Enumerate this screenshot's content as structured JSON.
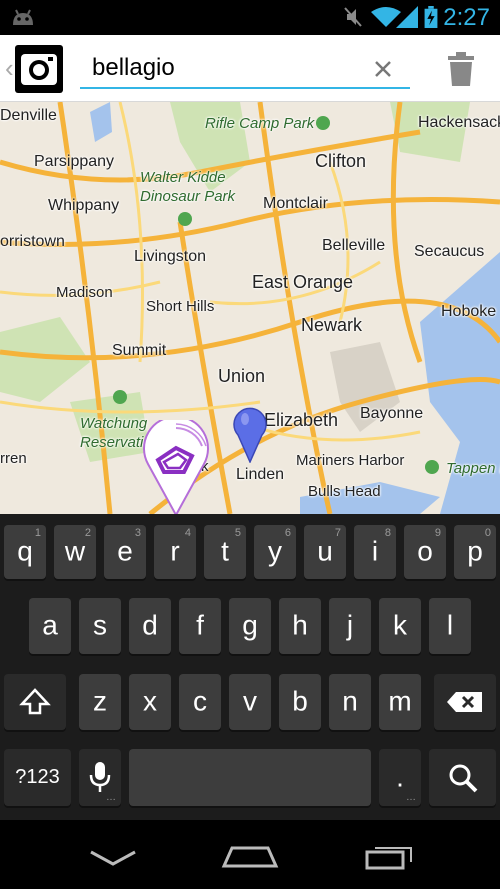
{
  "statusbar": {
    "time": "2:27",
    "icons": [
      "android-icon",
      "mute-icon",
      "wifi-icon",
      "signal-icon",
      "battery-charging-icon"
    ],
    "accent_color": "#33b5e5"
  },
  "actionbar": {
    "search_value": "bellagio",
    "app_icon": "camera-icon",
    "clear_icon": "close-icon",
    "trash_icon": "trash-icon"
  },
  "map": {
    "labels": [
      {
        "name": "Denville",
        "cls": ""
      },
      {
        "name": "Rifle Camp Park",
        "cls": "park"
      },
      {
        "name": "Hackensack",
        "cls": ""
      },
      {
        "name": "Parsippany",
        "cls": ""
      },
      {
        "name": "Clifton",
        "cls": "big"
      },
      {
        "name": "Walter Kidde Dinosaur Park",
        "cls": "park"
      },
      {
        "name": "Whippany",
        "cls": ""
      },
      {
        "name": "Montclair",
        "cls": ""
      },
      {
        "name": "orristown",
        "cls": ""
      },
      {
        "name": "Livingston",
        "cls": ""
      },
      {
        "name": "Belleville",
        "cls": ""
      },
      {
        "name": "Secaucus",
        "cls": ""
      },
      {
        "name": "Madison",
        "cls": ""
      },
      {
        "name": "East Orange",
        "cls": "big"
      },
      {
        "name": "Short Hills",
        "cls": ""
      },
      {
        "name": "Hoboke",
        "cls": ""
      },
      {
        "name": "Newark",
        "cls": "big"
      },
      {
        "name": "Summit",
        "cls": ""
      },
      {
        "name": "Union",
        "cls": "big"
      },
      {
        "name": "Watchung Reservation",
        "cls": "park"
      },
      {
        "name": "Elizabeth",
        "cls": "big"
      },
      {
        "name": "Bayonne",
        "cls": ""
      },
      {
        "name": "rren",
        "cls": ""
      },
      {
        "name": "Linden",
        "cls": ""
      },
      {
        "name": "Mariners Harbor",
        "cls": ""
      },
      {
        "name": "Tappen P",
        "cls": "park"
      },
      {
        "name": "Bulls Head",
        "cls": ""
      },
      {
        "name": "k",
        "cls": ""
      }
    ],
    "marker_icon": "map-pin-icon",
    "location_icon": "location-marker-icon"
  },
  "keyboard": {
    "row1": [
      {
        "label": "q",
        "hint": "1"
      },
      {
        "label": "w",
        "hint": "2"
      },
      {
        "label": "e",
        "hint": "3"
      },
      {
        "label": "r",
        "hint": "4"
      },
      {
        "label": "t",
        "hint": "5"
      },
      {
        "label": "y",
        "hint": "6"
      },
      {
        "label": "u",
        "hint": "7"
      },
      {
        "label": "i",
        "hint": "8"
      },
      {
        "label": "o",
        "hint": "9"
      },
      {
        "label": "p",
        "hint": "0"
      }
    ],
    "row2": [
      "a",
      "s",
      "d",
      "f",
      "g",
      "h",
      "j",
      "k",
      "l"
    ],
    "row3": [
      "z",
      "x",
      "c",
      "v",
      "b",
      "n",
      "m"
    ],
    "shift_icon": "shift-icon",
    "backspace_icon": "backspace-icon",
    "symbols_label": "?123",
    "mic_icon": "microphone-icon",
    "period_label": ".",
    "search_icon": "search-icon"
  },
  "navbar": {
    "back_icon": "back-icon",
    "home_icon": "home-icon",
    "recents_icon": "recents-icon"
  }
}
